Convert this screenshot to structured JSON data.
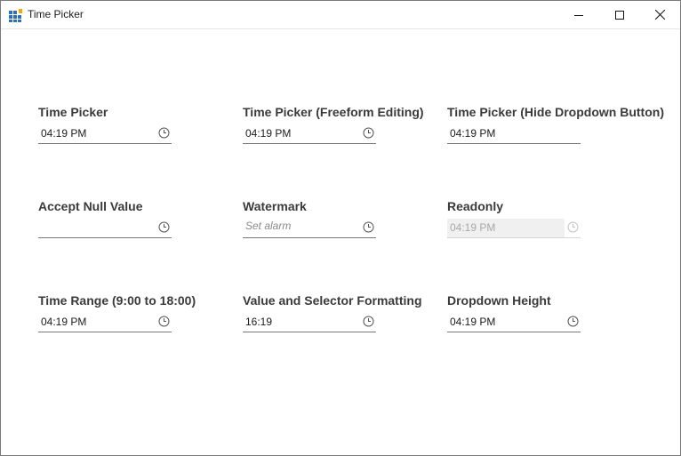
{
  "window": {
    "title": "Time Picker",
    "icons": {
      "app": "app-grid-icon",
      "minimize": "minimize-icon",
      "maximize": "maximize-icon",
      "close": "close-icon"
    }
  },
  "fields": [
    {
      "label": "Time Picker",
      "value": "04:19 PM",
      "placeholder": "",
      "dropdown_button": true,
      "readonly": false
    },
    {
      "label": "Time Picker (Freeform Editing)",
      "value": "04:19 PM",
      "placeholder": "",
      "dropdown_button": true,
      "readonly": false
    },
    {
      "label": "Time Picker (Hide Dropdown Button)",
      "value": "04:19 PM",
      "placeholder": "",
      "dropdown_button": false,
      "readonly": false
    },
    {
      "label": "Accept Null Value",
      "value": "",
      "placeholder": "",
      "dropdown_button": true,
      "readonly": false
    },
    {
      "label": "Watermark",
      "value": "",
      "placeholder": "Set alarm",
      "dropdown_button": true,
      "readonly": false
    },
    {
      "label": "Readonly",
      "value": "04:19 PM",
      "placeholder": "",
      "dropdown_button": true,
      "readonly": true
    },
    {
      "label": "Time Range (9:00 to 18:00)",
      "value": "04:19 PM",
      "placeholder": "",
      "dropdown_button": true,
      "readonly": false
    },
    {
      "label": "Value and Selector Formatting",
      "value": "16:19",
      "placeholder": "",
      "dropdown_button": true,
      "readonly": false
    },
    {
      "label": "Dropdown Height",
      "value": "04:19 PM",
      "placeholder": "",
      "dropdown_button": true,
      "readonly": false
    }
  ],
  "colors": {
    "readonly_text": "#a8a8a8",
    "watermark_text": "#8a8a8a",
    "underline": "#777777"
  }
}
